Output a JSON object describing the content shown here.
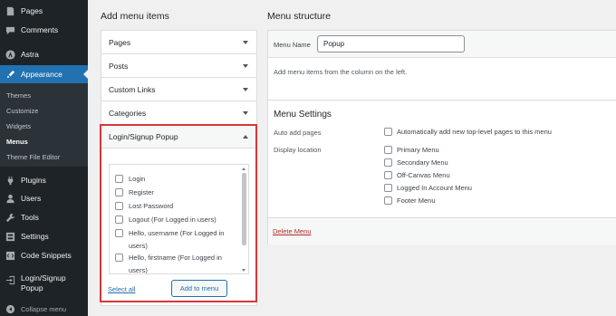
{
  "sidebar": {
    "items": [
      {
        "label": "Pages",
        "icon": "pages-icon"
      },
      {
        "label": "Comments",
        "icon": "comments-icon"
      },
      {
        "label": "Astra",
        "icon": "astra-icon"
      },
      {
        "label": "Appearance",
        "icon": "appearance-icon"
      },
      {
        "label": "Plugins",
        "icon": "plugins-icon"
      },
      {
        "label": "Users",
        "icon": "users-icon"
      },
      {
        "label": "Tools",
        "icon": "tools-icon"
      },
      {
        "label": "Settings",
        "icon": "settings-icon"
      },
      {
        "label": "Code Snippets",
        "icon": "code-snippets-icon"
      },
      {
        "label": "Login/Signup",
        "label2": "Popup",
        "icon": "login-signup-icon"
      },
      {
        "label": "Collapse menu",
        "icon": "collapse-icon"
      }
    ],
    "submenu": [
      "Themes",
      "Customize",
      "Widgets",
      "Menus",
      "Theme File Editor"
    ],
    "active": "Appearance",
    "current_sub": "Menus"
  },
  "left": {
    "heading": "Add menu items",
    "sections": [
      "Pages",
      "Posts",
      "Custom Links",
      "Categories",
      "Login/Signup Popup"
    ],
    "popup_items": [
      "Login",
      "Register",
      "Lost Password",
      "Logout (For Logged in users)",
      "Hello, username (For Logged in users)",
      "Hello, firstname (For Logged in users)"
    ],
    "select_all": "Select all",
    "add_button": "Add to menu"
  },
  "right": {
    "heading": "Menu structure",
    "menu_name_label": "Menu Name",
    "menu_name_value": "Popup",
    "help_text": "Add menu items from the column on the left.",
    "settings_title": "Menu Settings",
    "auto_add_label": "Auto add pages",
    "auto_add_option": "Automatically add new top-level pages to this menu",
    "display_location_label": "Display location",
    "locations": [
      "Primary Menu",
      "Secondary Menu",
      "Off-Canvas Menu",
      "Logged In Account Menu",
      "Footer Menu"
    ],
    "delete_menu": "Delete Menu"
  },
  "colors": {
    "sidebar_bg": "#1d2327",
    "active": "#2271b1",
    "highlight_border": "#d63638",
    "delete": "#b32d2e"
  }
}
